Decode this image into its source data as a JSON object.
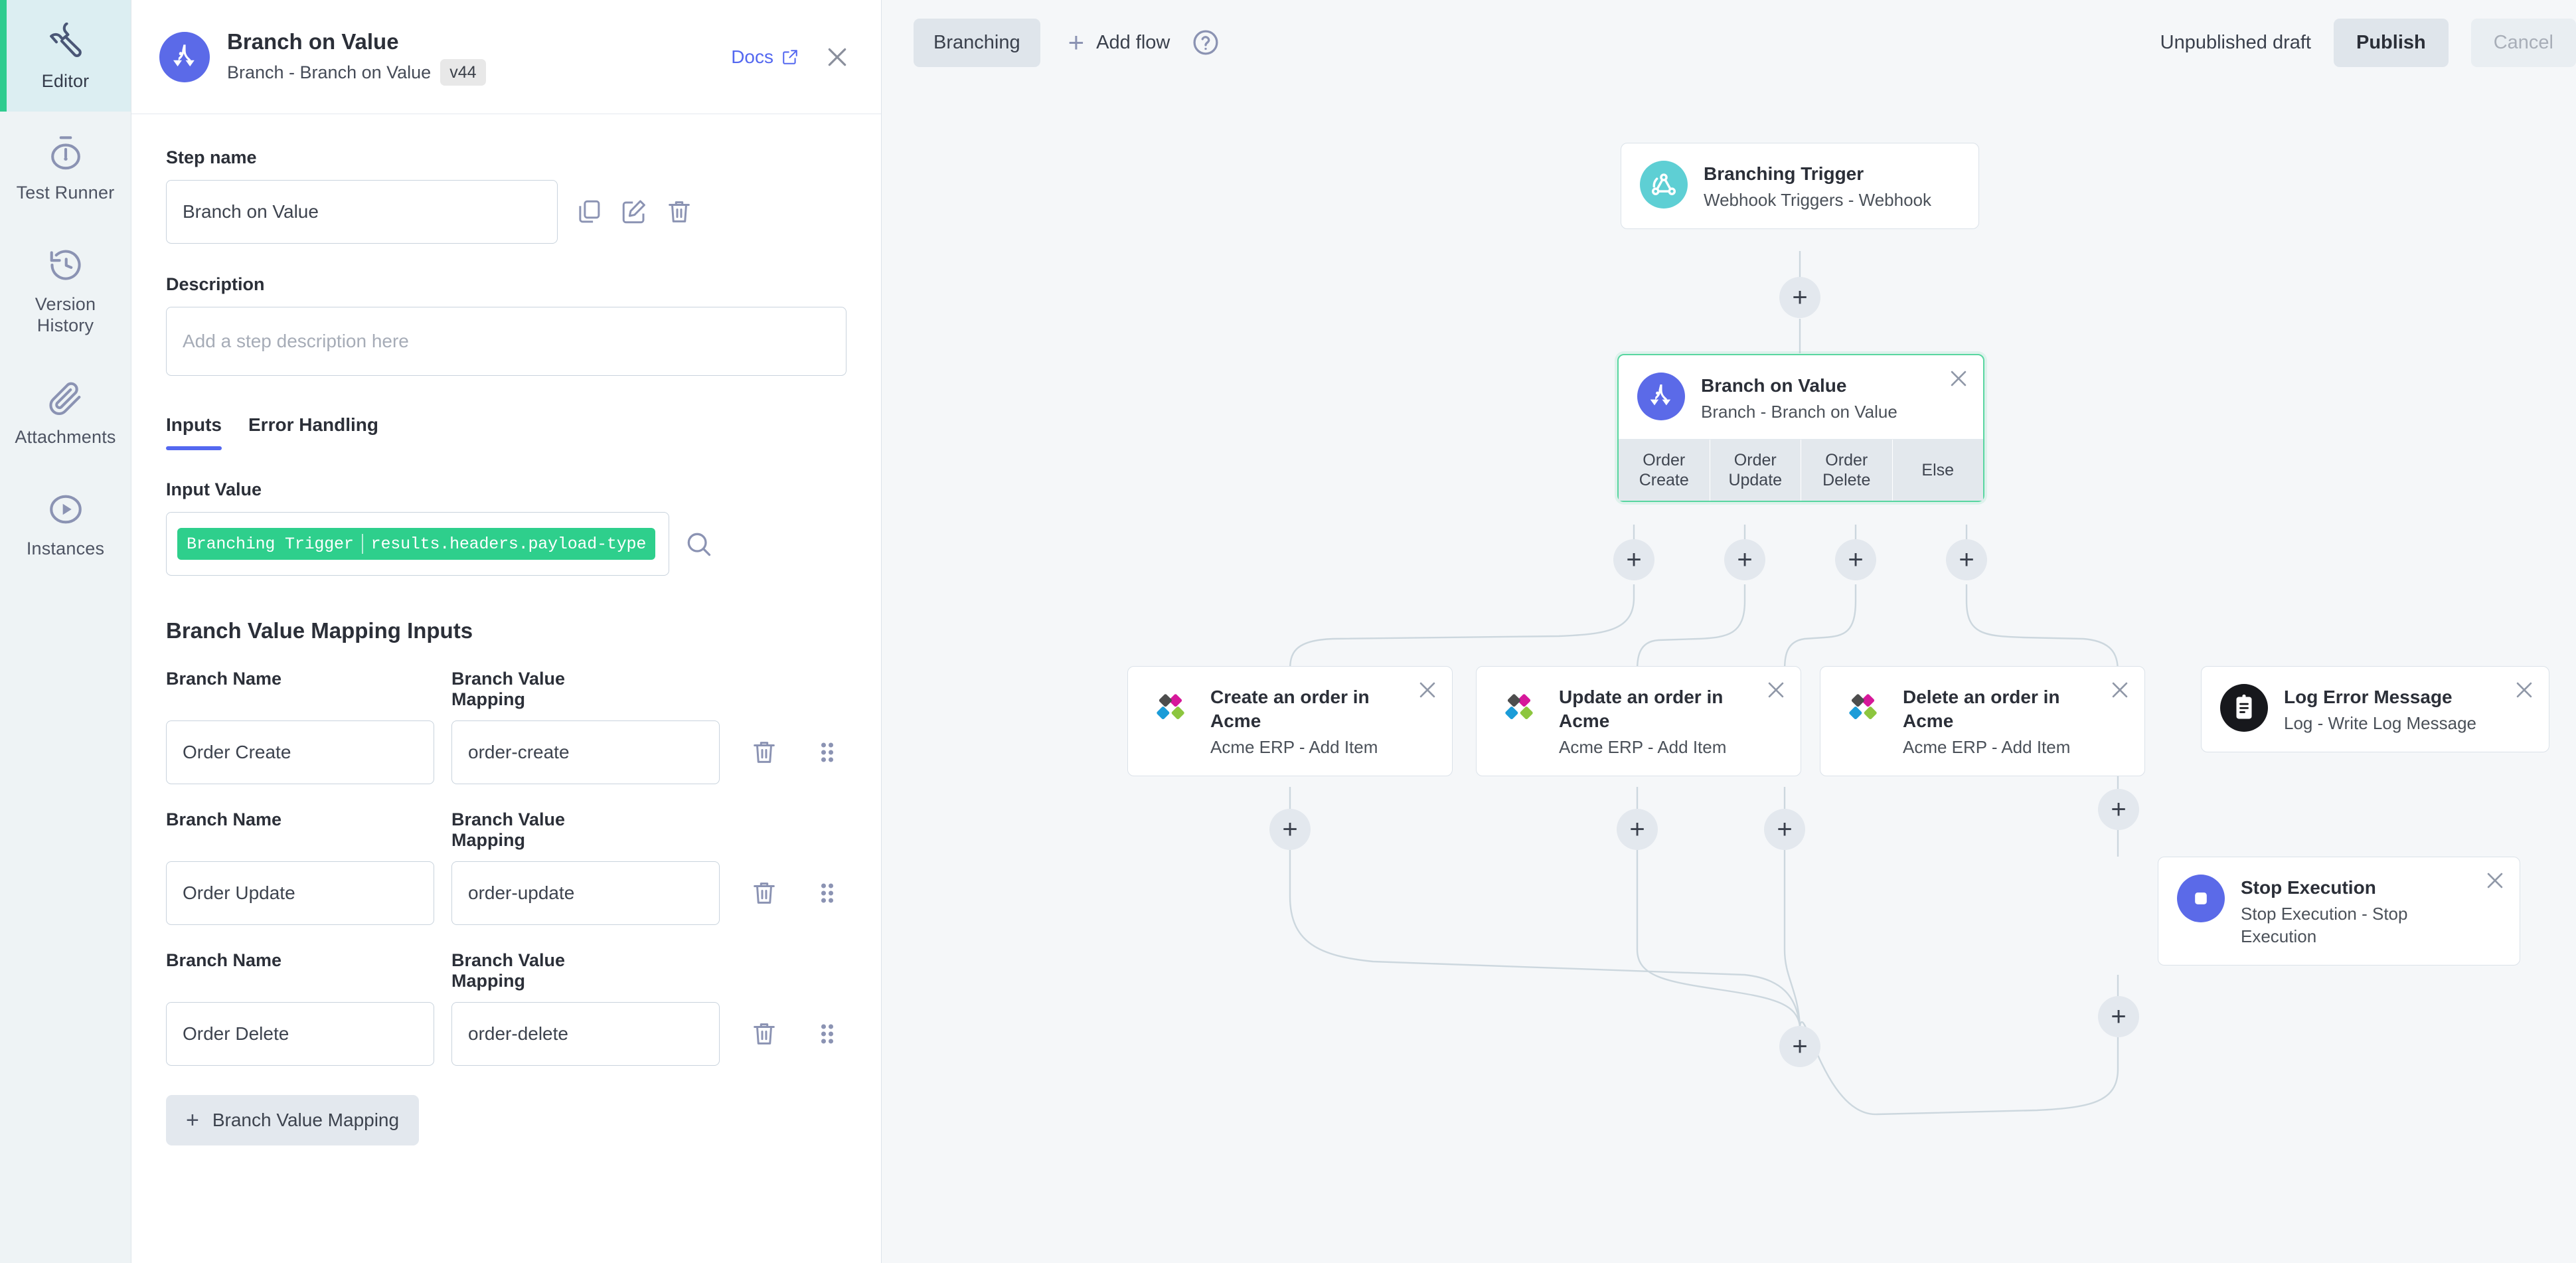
{
  "rail": {
    "items": [
      {
        "label": "Editor",
        "icon": "wrench-icon",
        "active": true
      },
      {
        "label": "Test Runner",
        "icon": "stopwatch-icon",
        "active": false
      },
      {
        "label": "Version History",
        "icon": "history-clock-icon",
        "active": false
      },
      {
        "label": "Attachments",
        "icon": "paperclip-icon",
        "active": false
      },
      {
        "label": "Instances",
        "icon": "play-circle-icon",
        "active": false
      }
    ]
  },
  "panel": {
    "title": "Branch on Value",
    "subtitle": "Branch - Branch on Value",
    "version": "v44",
    "docs_label": "Docs",
    "step_name_label": "Step name",
    "step_name_value": "Branch on Value",
    "description_label": "Description",
    "description_placeholder": "Add a step description here",
    "tabs": [
      {
        "label": "Inputs",
        "active": true
      },
      {
        "label": "Error Handling",
        "active": false
      }
    ],
    "input_value_label": "Input Value",
    "input_value_chip": {
      "source": "Branching Trigger",
      "path": "results.headers.payload-type"
    },
    "mapping_section_title": "Branch Value Mapping Inputs",
    "col_name_label": "Branch Name",
    "col_value_label": "Branch Value Mapping",
    "mappings": [
      {
        "name": "Order Create",
        "value": "order-create"
      },
      {
        "name": "Order Update",
        "value": "order-update"
      },
      {
        "name": "Order Delete",
        "value": "order-delete"
      }
    ],
    "add_mapping_label": "Branch Value Mapping"
  },
  "toolbar": {
    "flow_tab": "Branching",
    "add_flow_label": "Add flow",
    "help_icon": "question-circle-icon",
    "draft_status": "Unpublished draft",
    "publish_label": "Publish",
    "cancel_label": "Cancel"
  },
  "flow": {
    "nodes": [
      {
        "id": "trigger",
        "title": "Branching Trigger",
        "subtitle": "Webhook Triggers - Webhook",
        "icon": "webhook-icon",
        "icon_bg": "#5ecfd4",
        "closable": false,
        "selected": false
      },
      {
        "id": "branch",
        "title": "Branch on Value",
        "subtitle": "Branch - Branch on Value",
        "icon": "branch-icon",
        "icon_bg": "#5b6ae8",
        "closable": true,
        "selected": true,
        "branches": [
          "Order Create",
          "Order Update",
          "Order Delete",
          "Else"
        ]
      },
      {
        "id": "create-order",
        "title": "Create an order in Acme",
        "subtitle": "Acme ERP - Add Item",
        "icon": "acme-diamond-icon",
        "icon_bg": "transparent",
        "closable": true,
        "selected": false
      },
      {
        "id": "update-order",
        "title": "Update an order in Acme",
        "subtitle": "Acme ERP - Add Item",
        "icon": "acme-diamond-icon",
        "icon_bg": "transparent",
        "closable": true,
        "selected": false
      },
      {
        "id": "delete-order",
        "title": "Delete an order in Acme",
        "subtitle": "Acme ERP - Add Item",
        "icon": "acme-diamond-icon",
        "icon_bg": "transparent",
        "closable": true,
        "selected": false
      },
      {
        "id": "log-error",
        "title": "Log Error Message",
        "subtitle": "Log - Write Log Message",
        "icon": "clipboard-log-icon",
        "icon_bg": "#17181c",
        "closable": true,
        "selected": false
      },
      {
        "id": "stop-exec",
        "title": "Stop Execution",
        "subtitle": "Stop Execution - Stop Execution",
        "icon": "stop-square-icon",
        "icon_bg": "#5b6ae8",
        "closable": true,
        "selected": false
      }
    ],
    "add_step_label": "+"
  },
  "colors": {
    "accent_blue": "#5468f0",
    "accent_green": "#2ecf8c",
    "selected_border": "#58d6a0",
    "rail_active_bar": "#2ecc8f",
    "canvas_bg": "#f5f7f9"
  }
}
